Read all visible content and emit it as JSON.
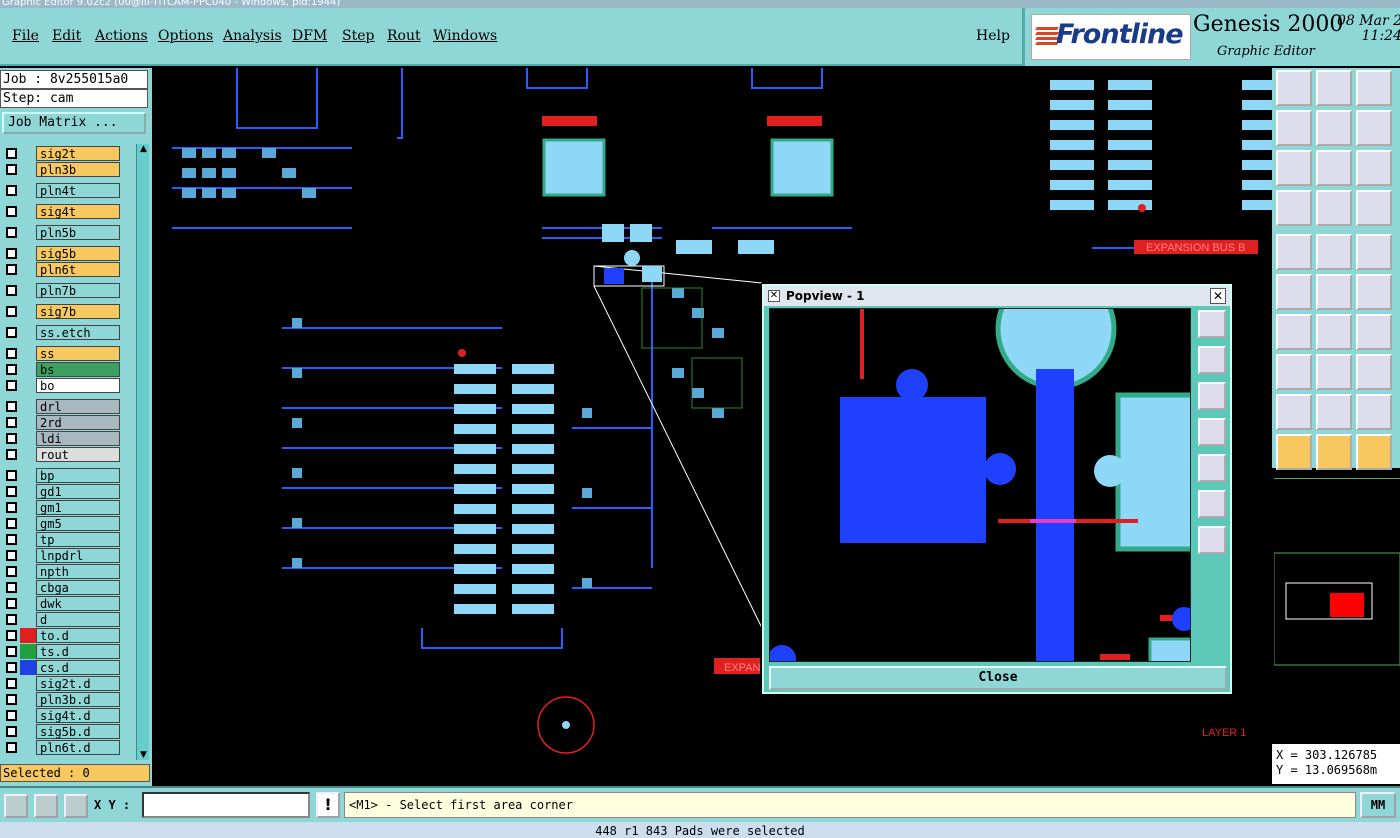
{
  "window": {
    "title": "Graphic Editor 9.02c2 (00@III-TITCAM-PPC040 - Windows, pid:1944)"
  },
  "menu": {
    "items": [
      "File",
      "Edit",
      "Actions",
      "Options",
      "Analysis",
      "DFM",
      "Step",
      "Rout",
      "Windows"
    ],
    "help": "Help"
  },
  "brand": {
    "logo": "Frontline",
    "product": "Genesis 2000",
    "subtitle": "Graphic Editor",
    "date": "08 Mar 2",
    "time": "11:24"
  },
  "job": {
    "job_line": "Job : 8v255015a0",
    "step_line": "Step: cam",
    "matrix_button": "Job Matrix ..."
  },
  "layers": [
    {
      "name": "sig2t",
      "bg": "#f8c860",
      "color": ""
    },
    {
      "name": "pln3b",
      "bg": "#f8c860",
      "color": ""
    },
    {
      "name": "pln4t",
      "bg": "#8fd7d7",
      "color": ""
    },
    {
      "name": "sig4t",
      "bg": "#f8c860",
      "color": ""
    },
    {
      "name": "pln5b",
      "bg": "#8fd7d7",
      "color": ""
    },
    {
      "name": "sig5b",
      "bg": "#f8c860",
      "color": ""
    },
    {
      "name": "pln6t",
      "bg": "#f8c860",
      "color": ""
    },
    {
      "name": "pln7b",
      "bg": "#8fd7d7",
      "color": ""
    },
    {
      "name": "sig7b",
      "bg": "#f8c860",
      "color": ""
    },
    {
      "name": "ss.etch",
      "bg": "#8fd7d7",
      "color": ""
    },
    {
      "name": "ss",
      "bg": "#f8c860",
      "color": ""
    },
    {
      "name": "bs",
      "bg": "#3ca060",
      "color": ""
    },
    {
      "name": "bo",
      "bg": "#ffffff",
      "color": ""
    },
    {
      "name": "drl",
      "bg": "#a8b8c0",
      "color": ""
    },
    {
      "name": "2rd",
      "bg": "#a8b8c0",
      "color": ""
    },
    {
      "name": "ldi",
      "bg": "#a8b8c0",
      "color": ""
    },
    {
      "name": "rout",
      "bg": "#dddddd",
      "color": ""
    },
    {
      "name": "bp",
      "bg": "#8fd7d7",
      "color": ""
    },
    {
      "name": "gd1",
      "bg": "#8fd7d7",
      "color": ""
    },
    {
      "name": "gm1",
      "bg": "#8fd7d7",
      "color": ""
    },
    {
      "name": "gm5",
      "bg": "#8fd7d7",
      "color": ""
    },
    {
      "name": "tp",
      "bg": "#8fd7d7",
      "color": ""
    },
    {
      "name": "lnpdrl",
      "bg": "#8fd7d7",
      "color": ""
    },
    {
      "name": "npth",
      "bg": "#8fd7d7",
      "color": ""
    },
    {
      "name": "cbga",
      "bg": "#8fd7d7",
      "color": ""
    },
    {
      "name": "dwk",
      "bg": "#8fd7d7",
      "color": ""
    },
    {
      "name": "d",
      "bg": "#8fd7d7",
      "color": ""
    },
    {
      "name": "to.d",
      "bg": "#8fd7d7",
      "color": "#e02020"
    },
    {
      "name": "ts.d",
      "bg": "#8fd7d7",
      "color": "#20a040"
    },
    {
      "name": "cs.d",
      "bg": "#8fd7d7",
      "color": "#2040e0"
    },
    {
      "name": "sig2t.d",
      "bg": "#8fd7d7",
      "color": ""
    },
    {
      "name": "pln3b.d",
      "bg": "#8fd7d7",
      "color": ""
    },
    {
      "name": "sig4t.d",
      "bg": "#8fd7d7",
      "color": ""
    },
    {
      "name": "sig5b.d",
      "bg": "#8fd7d7",
      "color": ""
    },
    {
      "name": "pln6t.d",
      "bg": "#8fd7d7",
      "color": ""
    }
  ],
  "selected": "Selected : 0",
  "canvas": {
    "labels": [
      "EXPANSION BUS B",
      "EXPAN",
      "LAYER 1"
    ]
  },
  "popview": {
    "title": "Popview - 1",
    "close_button": "Close"
  },
  "coords": {
    "x": "X = 303.126785",
    "y": "Y = 13.069568m"
  },
  "bottom": {
    "xy_label": "X Y :",
    "xy_value": "",
    "prompt": "<M1> - Select first area corner",
    "units": "MM",
    "status": "448 r1 843 Pads were selected"
  },
  "icons": {
    "toolbar": [
      "zoom-in-icon",
      "zoom-out-icon",
      "home-icon",
      "pan-left-icon",
      "pan-right-icon",
      "grid-icon",
      "fit-icon",
      "center-icon",
      "one-to-one-icon",
      "palette-icon",
      "snap-icon",
      "traffic-icon",
      "measure-icon",
      "edit-icon",
      "ruler-icon",
      "net-icon",
      "cut-icon",
      "snap2-icon",
      "line-icon",
      "line2-icon",
      "arc-icon",
      "pad-icon",
      "line3-icon",
      "ruler2-icon",
      "tri-icon",
      "tri2-icon",
      "tri3-icon",
      "pointer-icon",
      "pointer2-icon",
      "pointer3-icon"
    ]
  }
}
